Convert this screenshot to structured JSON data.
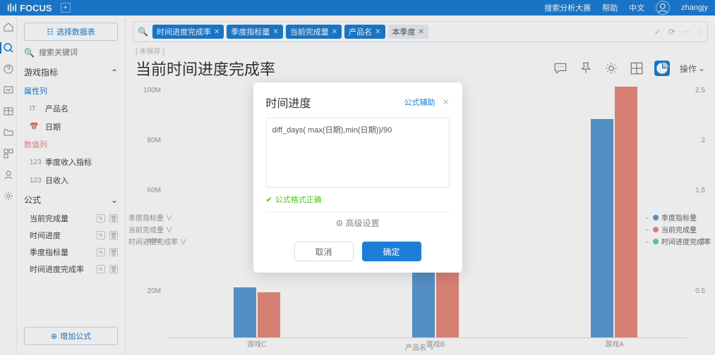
{
  "brand": "FOCUS",
  "top_links": {
    "a": "搜索分析大赛",
    "b": "帮助",
    "c": "中文",
    "user": "zhangjy"
  },
  "rail": [
    "home",
    "search",
    "help",
    "board",
    "table",
    "folder",
    "module",
    "users",
    "settings"
  ],
  "side": {
    "select_ds": "选择数据表",
    "search_ph": "搜索关键词",
    "sec1": "游戏指标",
    "attr": "属性列",
    "attrs": [
      {
        "t": "tT",
        "n": "产品名"
      },
      {
        "t": "📅",
        "n": "日期"
      }
    ],
    "meas": "数值列",
    "meass": [
      {
        "t": "123",
        "n": "季度收入指标"
      },
      {
        "t": "123",
        "n": "日收入"
      }
    ],
    "formula": "公式",
    "fitems": [
      "当前完成量",
      "时间进度",
      "季度指标量",
      "时间进度完成率"
    ],
    "add": "增加公式"
  },
  "query": {
    "chips": [
      {
        "t": "时间进度完成率",
        "c": "b"
      },
      {
        "t": "季度指标量",
        "c": "b"
      },
      {
        "t": "当前完成量",
        "c": "b"
      },
      {
        "t": "产品名",
        "c": "b"
      },
      {
        "t": "本季度",
        "c": "g"
      }
    ]
  },
  "crumb": "[ 未保存 ]",
  "title": "当前时间进度完成率",
  "op": "操作",
  "series_labels": [
    "季度指标量 ∨",
    "当前完成量 ∨",
    "时间进度完成率 ∨"
  ],
  "legend": [
    {
      "c": "#5b9bd5",
      "n": "季度指标量"
    },
    {
      "c": "#e88b7d",
      "n": "当前完成量"
    },
    {
      "c": "#6fcf97",
      "n": "时间进度完成率"
    }
  ],
  "xaxis_title": "产品名 ∨",
  "chart_data": {
    "type": "bar",
    "categories": [
      "游戏C",
      "游戏B",
      "游戏A"
    ],
    "series": [
      {
        "name": "季度指标量",
        "values": [
          20000000,
          55000000,
          87000000
        ]
      },
      {
        "name": "当前完成量",
        "values": [
          18000000,
          42000000,
          100000000
        ]
      }
    ],
    "yticks": [
      "100M",
      "80M",
      "60M",
      "40M",
      "20M"
    ],
    "ylim": [
      0,
      100000000
    ],
    "y2ticks": [
      "2.5",
      "2",
      "1.5",
      "1",
      "0.5"
    ]
  },
  "modal": {
    "title": "时间进度",
    "aux": "公式辅助",
    "formula": "diff_days( max(日期),min(日期))/90",
    "ok": "公式格式正确",
    "adv": "高级设置",
    "cancel": "取消",
    "confirm": "确定"
  }
}
